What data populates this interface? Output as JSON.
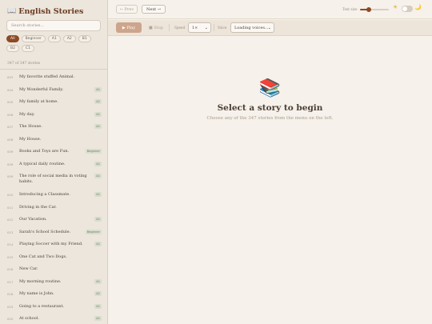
{
  "sidebar": {
    "brand_icon": "📖",
    "brand_title": "English Stories",
    "search_placeholder": "Search stories...",
    "chips": [
      "All",
      "Beginner",
      "A1",
      "A2",
      "B1",
      "B2",
      "C1"
    ],
    "active_chip": "All",
    "count": "347 of 347 stories",
    "stories": [
      {
        "num": "003",
        "title": "My favorite stuffed Animal.",
        "level": ""
      },
      {
        "num": "004",
        "title": "My Wonderful Family.",
        "level": "A1"
      },
      {
        "num": "005",
        "title": "My family at home.",
        "level": "A1"
      },
      {
        "num": "006",
        "title": "My day.",
        "level": "A1"
      },
      {
        "num": "007",
        "title": "The House.",
        "level": "A1"
      },
      {
        "num": "008",
        "title": "My House.",
        "level": ""
      },
      {
        "num": "009",
        "title": "Books and Toys are Fun.",
        "level": "Beginner"
      },
      {
        "num": "009",
        "title": "A typical daily routine.",
        "level": "A1"
      },
      {
        "num": "009",
        "title": "The role of social media in voting habits.",
        "level": "A1"
      },
      {
        "num": "010",
        "title": "Introducing a Classmate.",
        "level": "A1"
      },
      {
        "num": "011",
        "title": "Driving in the Car.",
        "level": ""
      },
      {
        "num": "012",
        "title": "Our Vacation.",
        "level": "A1"
      },
      {
        "num": "013",
        "title": "Sarah's School Schedule.",
        "level": "Beginner"
      },
      {
        "num": "014",
        "title": "Playing Soccer with my Friend.",
        "level": "A1"
      },
      {
        "num": "015",
        "title": "One Cat and Two Dogs.",
        "level": ""
      },
      {
        "num": "016",
        "title": "New Car.",
        "level": ""
      },
      {
        "num": "017",
        "title": "My morning routine.",
        "level": "A1"
      },
      {
        "num": "018",
        "title": "My name is John.",
        "level": "A1"
      },
      {
        "num": "019",
        "title": "Going to a restaurant.",
        "level": "A1"
      },
      {
        "num": "020",
        "title": "At school.",
        "level": "A1"
      }
    ]
  },
  "topbar": {
    "prev_label": "← Prev",
    "next_label": "Next →",
    "text_size_label": "Text size",
    "text_size_value": 0.3,
    "sun_icon": "☀",
    "moon_icon": "🌙"
  },
  "controls": {
    "play_label": "▶ Play",
    "stop_label": "■ Stop",
    "speed_label": "Speed",
    "speed_value": "1×",
    "voice_label": "Voice",
    "voice_value": "Loading voices..."
  },
  "empty_state": {
    "icon": "📚",
    "title": "Select a story to begin",
    "subtitle": "Choose any of the 347 stories from the menu on the left."
  },
  "colors": {
    "accent": "#8c4a25",
    "level_badge_bg": "#d9dece",
    "background": "#f6f1ea"
  }
}
